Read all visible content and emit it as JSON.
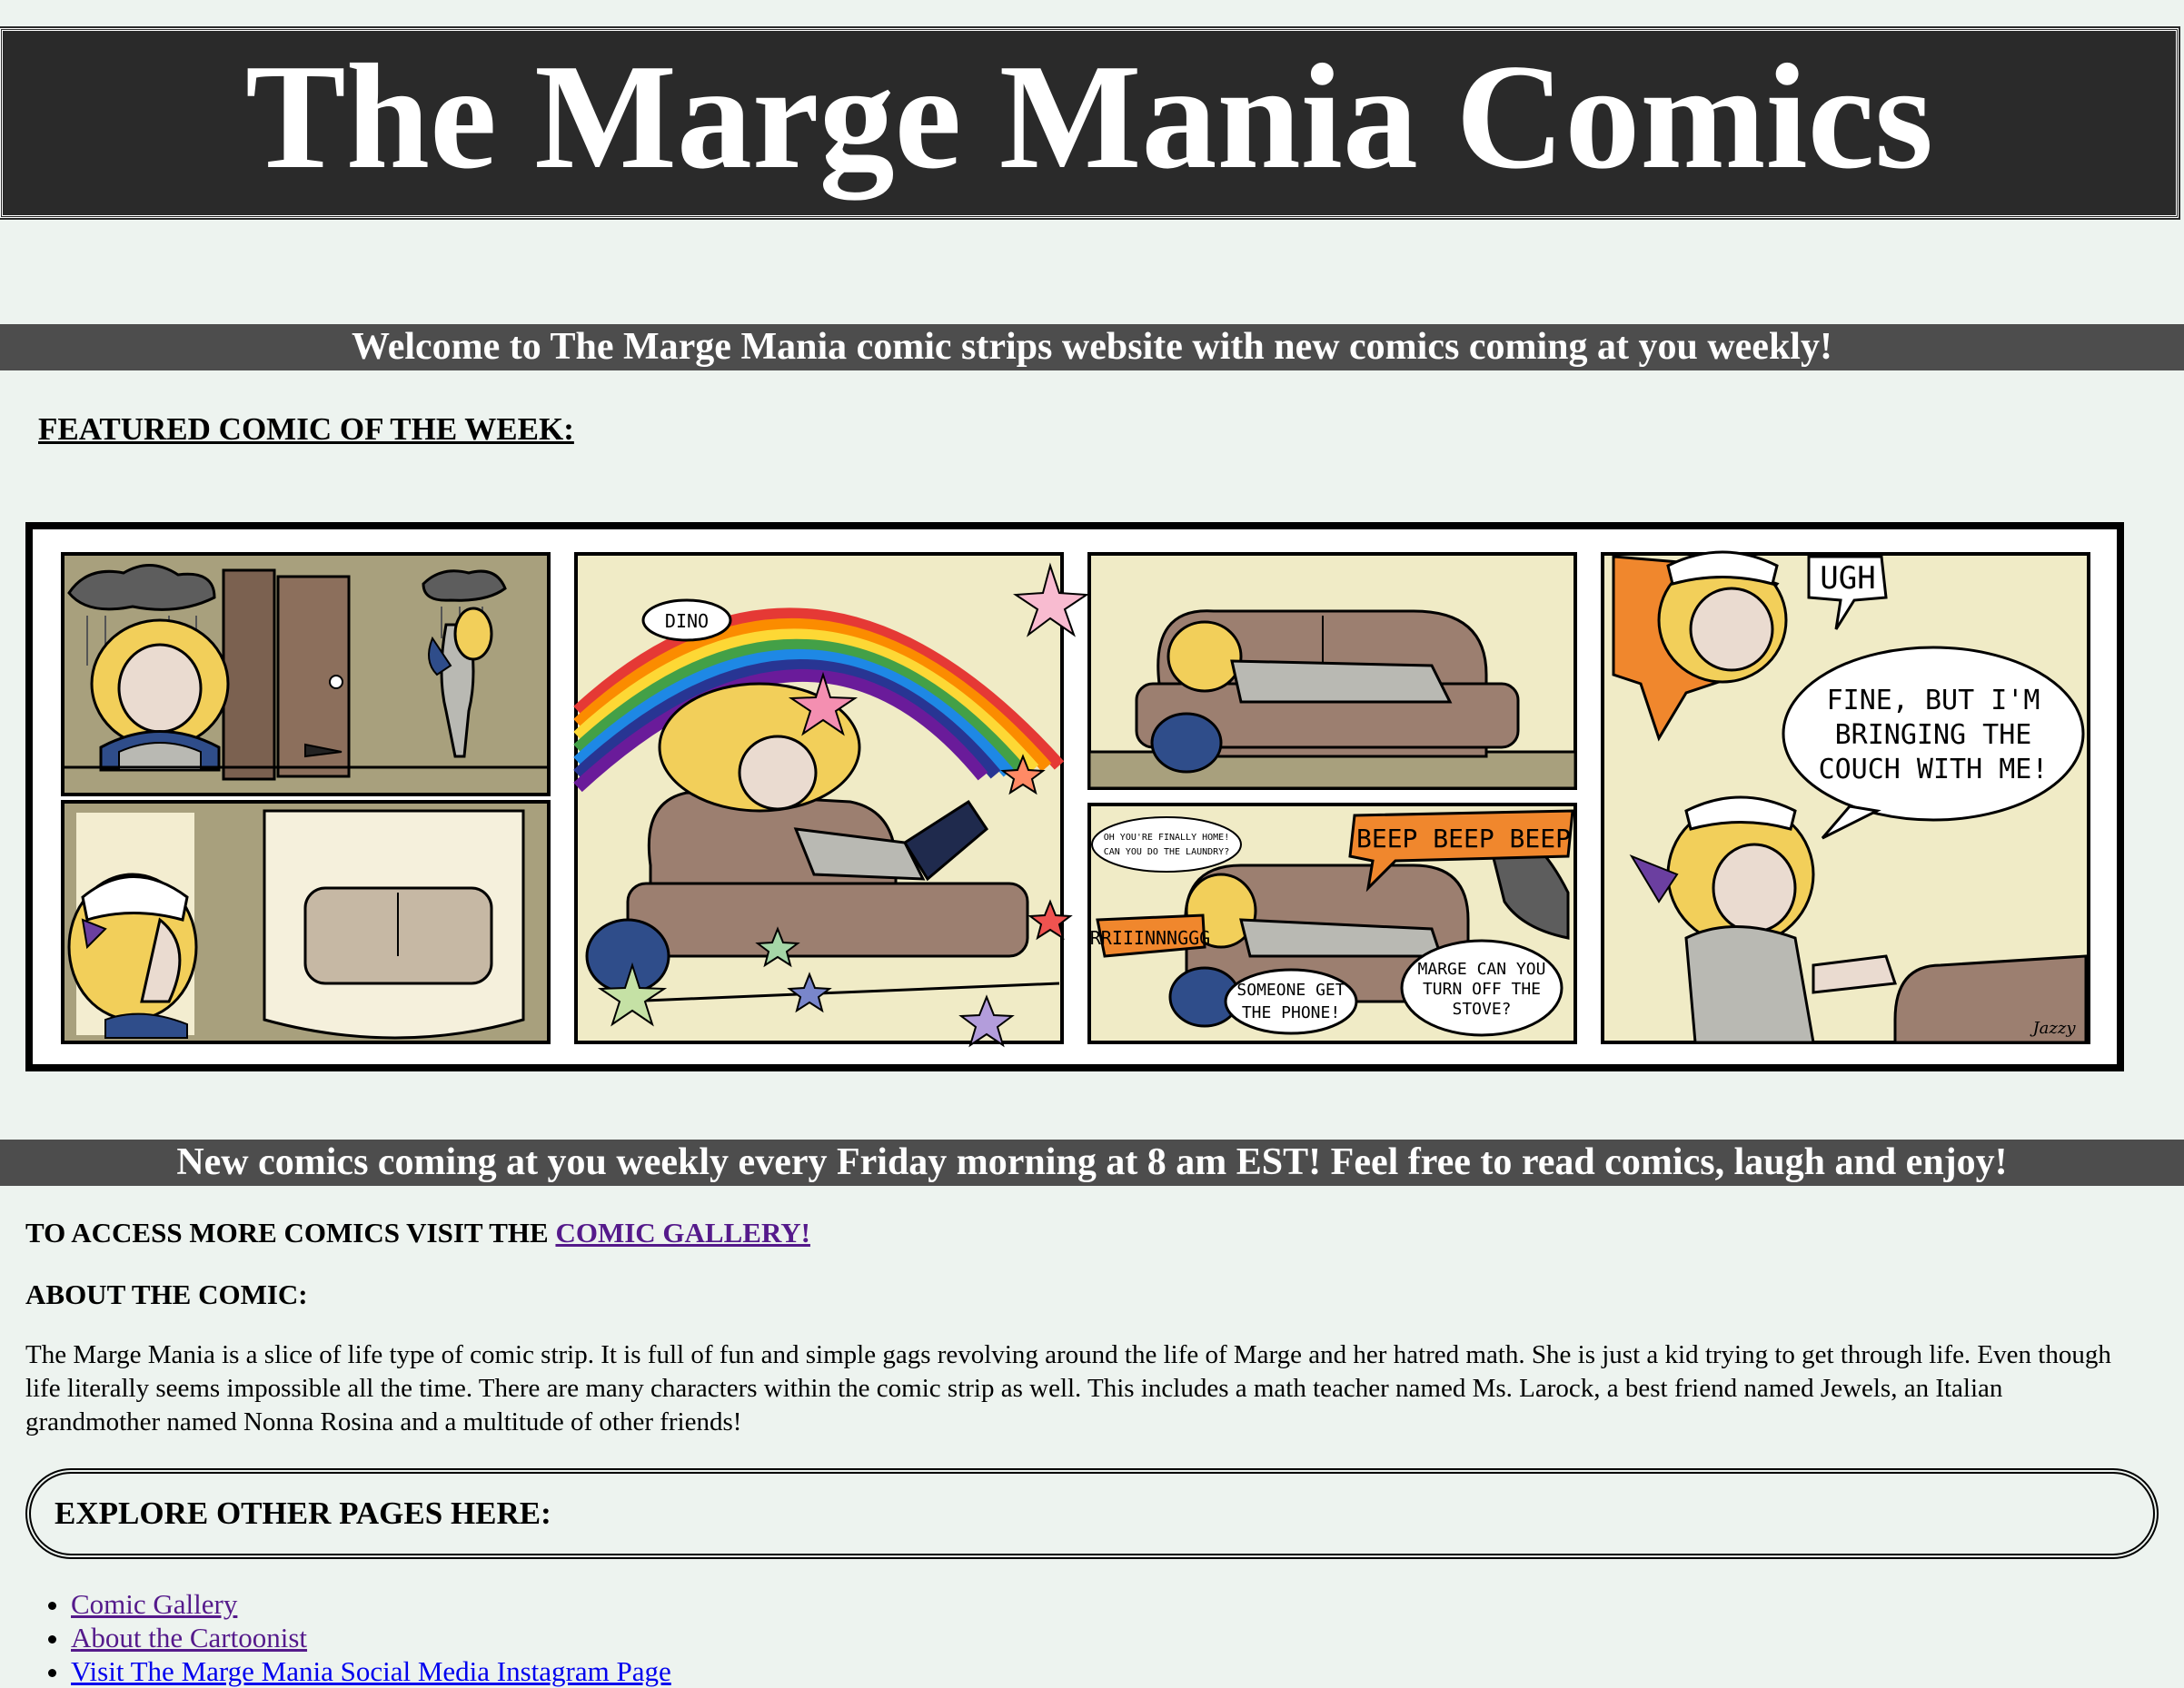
{
  "site": {
    "title": "The Marge Mania Comics"
  },
  "welcome_banner": "Welcome to The Marge Mania comic strips website with new comics coming at you weekly!",
  "featured_heading": "FEATURED COMIC OF THE WEEK:",
  "comic": {
    "panel2_cap": "DINO",
    "panel4_bubble1": "UGH",
    "panel4_bubble2_line1": "FINE, BUT I'M",
    "panel4_bubble2_line2": "BRINGING THE",
    "panel4_bubble2_line3": "COUCH WITH ME!",
    "panel5_bubble1_line1": "OH YOU'RE FINALLY HOME!",
    "panel5_bubble1_line2": "CAN YOU DO THE LAUNDRY?",
    "panel5_alarm": "BEEP BEEP BEEP",
    "panel5_phone": "RRIIINNNGGG",
    "panel5_bubble2_line1": "SOMEONE GET",
    "panel5_bubble2_line2": "THE PHONE!",
    "panel5_bubble3_line1": "MARGE CAN YOU",
    "panel5_bubble3_line2": "TURN OFF THE",
    "panel5_bubble3_line3": "STOVE?",
    "signature": "Jazzy",
    "colors": {
      "panel_bg": "#f0ebc6",
      "couch": "#9c7f70",
      "hair": "#f2cf5a",
      "orange": "#f0872d",
      "cloud": "#5d5d5d"
    }
  },
  "schedule_banner": "New comics coming at you weekly every Friday morning at 8 am EST! Feel free to read comics, laugh and enjoy!",
  "access": {
    "prefix": "TO ACCESS MORE COMICS VISIT THE ",
    "link": "COMIC GALLERY!"
  },
  "about": {
    "heading": "ABOUT THE COMIC:",
    "paragraph": "The Marge Mania is a slice of life type of comic strip. It is full of fun and simple gags revolving around the life of Marge and her hatred math. She is just a kid trying to get through life. Even though life literally seems impossible all the time. There are many characters within the comic strip as well. This includes a math teacher named Ms. Larock, a best friend named Jewels, an Italian grandmother named Nonna Rosina and a multitude of other friends!"
  },
  "explore": {
    "heading": "EXPLORE OTHER PAGES HERE:",
    "links": [
      "Comic Gallery",
      "About the Cartoonist",
      "Visit The Marge Mania Social Media Instagram Page"
    ]
  }
}
